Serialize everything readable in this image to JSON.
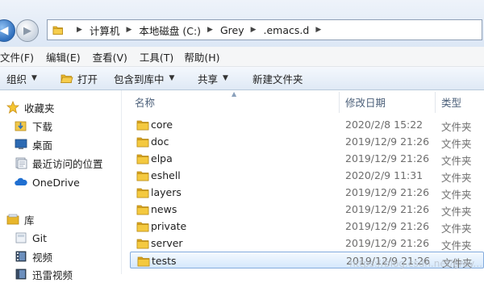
{
  "address": {
    "crumbs": [
      "计算机",
      "本地磁盘 (C:)",
      "Grey",
      ".emacs.d"
    ]
  },
  "menu": [
    "文件(F)",
    "编辑(E)",
    "查看(V)",
    "工具(T)",
    "帮助(H)"
  ],
  "toolbar": {
    "organize": "组织",
    "open": "打开",
    "include": "包含到库中",
    "share": "共享",
    "new_folder": "新建文件夹"
  },
  "nav": {
    "favorites": "收藏夹",
    "downloads": "下载",
    "desktop": "桌面",
    "recent": "最近访问的位置",
    "onedrive": "OneDrive",
    "libraries": "库",
    "git": "Git",
    "videos": "视频",
    "thunder": "迅雷视频"
  },
  "columns": {
    "name": "名称",
    "date": "修改日期",
    "type": "类型"
  },
  "files": [
    {
      "name": "core",
      "date": "2020/2/8 15:22",
      "type": "文件夹"
    },
    {
      "name": "doc",
      "date": "2019/12/9 21:26",
      "type": "文件夹"
    },
    {
      "name": "elpa",
      "date": "2019/12/9 21:26",
      "type": "文件夹"
    },
    {
      "name": "eshell",
      "date": "2020/2/9 11:31",
      "type": "文件夹"
    },
    {
      "name": "layers",
      "date": "2019/12/9 21:26",
      "type": "文件夹"
    },
    {
      "name": "news",
      "date": "2019/12/9 21:26",
      "type": "文件夹"
    },
    {
      "name": "private",
      "date": "2019/12/9 21:26",
      "type": "文件夹"
    },
    {
      "name": "server",
      "date": "2019/12/9 21:26",
      "type": "文件夹"
    },
    {
      "name": "tests",
      "date": "2019/12/9 21:26",
      "type": "文件夹"
    }
  ],
  "selected_row": "tests",
  "watermark": "https://blog.csdn.net/grey...",
  "colors": {
    "folder": "#e8b62c",
    "selection": "#cce4fb",
    "header_text": "#4c607a"
  }
}
